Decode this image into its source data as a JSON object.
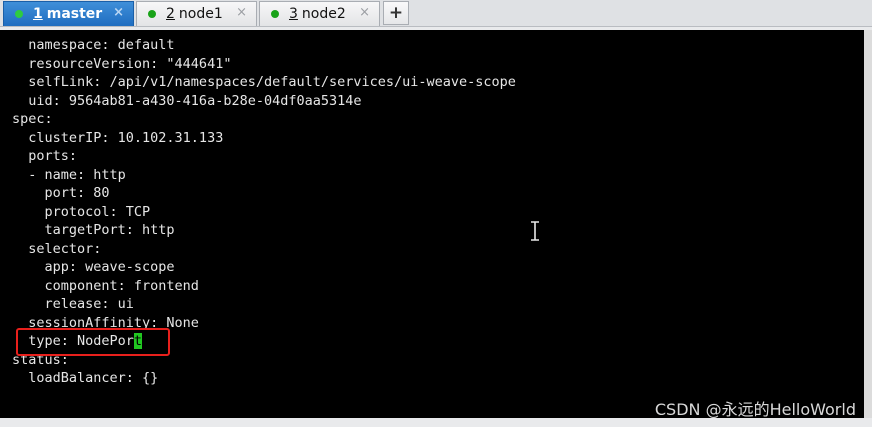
{
  "tabs": [
    {
      "number": "1",
      "name": "master",
      "active": true,
      "close": "×"
    },
    {
      "number": "2",
      "name": "node1",
      "active": false,
      "close": "×"
    },
    {
      "number": "3",
      "name": "node2",
      "active": false,
      "close": "×"
    }
  ],
  "tab_add_label": "+",
  "terminal": {
    "lines": [
      "  namespace: default",
      "  resourceVersion: \"444641\"",
      "  selfLink: /api/v1/namespaces/default/services/ui-weave-scope",
      "  uid: 9564ab81-a430-416a-b28e-04df0aa5314e",
      "spec:",
      "  clusterIP: 10.102.31.133",
      "  ports:",
      "  - name: http",
      "    port: 80",
      "    protocol: TCP",
      "    targetPort: http",
      "  selector:",
      "    app: weave-scope",
      "    component: frontend",
      "    release: ui",
      "  sessionAffinity: None",
      "  type: NodePor",
      "status:",
      "  loadBalancer: {}"
    ],
    "cursor_char": "t"
  },
  "watermark": "CSDN @永远的HelloWorld",
  "colors": {
    "terminal_bg": "#000000",
    "terminal_fg": "#e6e6e6",
    "cursor": "#21c721",
    "highlight_box": "#e8201c",
    "active_tab": "#1f6dc0",
    "status_dot": "#19a319"
  }
}
